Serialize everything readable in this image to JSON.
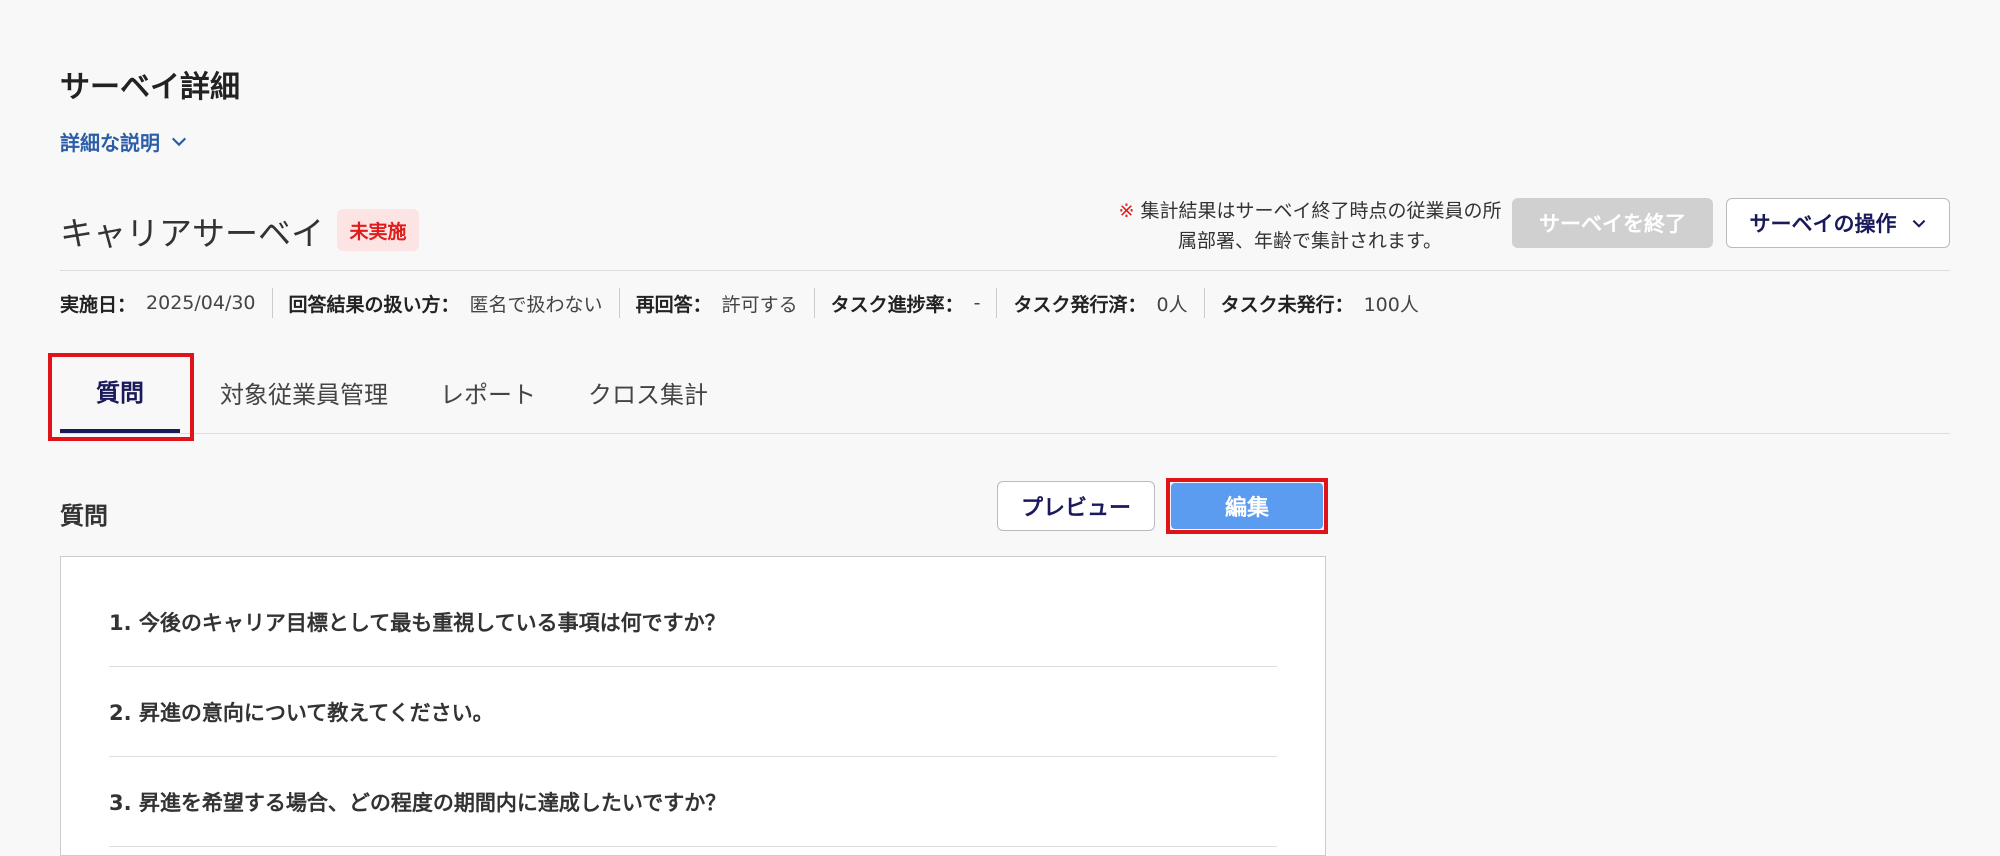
{
  "page": {
    "title": "サーベイ詳細",
    "description_toggle": "詳細な説明"
  },
  "survey": {
    "name": "キャリアサーベイ",
    "status": "未実施",
    "note_mark": "※",
    "note_text": "集計結果はサーベイ終了時点の従業員の所属部署、年齢で集計されます。",
    "end_button": "サーベイを終了",
    "ops_button": "サーベイの操作"
  },
  "meta": [
    {
      "label": "実施日：",
      "value": "2025/04/30"
    },
    {
      "label": "回答結果の扱い方：",
      "value": "匿名で扱わない"
    },
    {
      "label": "再回答：",
      "value": "許可する"
    },
    {
      "label": "タスク進捗率：",
      "value": "-"
    },
    {
      "label": "タスク発行済：",
      "value": "0人"
    },
    {
      "label": "タスク未発行：",
      "value": "100人"
    }
  ],
  "tabs": [
    "質問",
    "対象従業員管理",
    "レポート",
    "クロス集計"
  ],
  "questions_section": {
    "title": "質問",
    "preview_button": "プレビュー",
    "edit_button": "編集",
    "items": [
      "1. 今後のキャリア目標として最も重視している事項は何ですか？",
      "2. 昇進の意向について教えてください。",
      "3. 昇進を希望する場合、どの程度の期間内に達成したいですか？"
    ]
  },
  "colors": {
    "accent_navy": "#1a1a5a",
    "link_blue": "#2c5ea8",
    "edit_blue": "#5b9cf0",
    "status_red": "#e01b1b",
    "highlight_red": "#e0121a"
  }
}
